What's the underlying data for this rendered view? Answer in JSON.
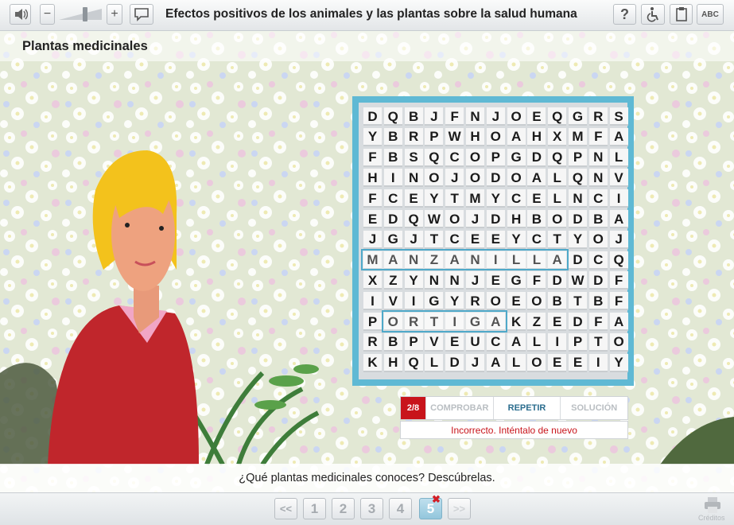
{
  "app": {
    "title": "Efectos positivos de los animales y las plantas sobre la salud humana",
    "tools": {
      "help_icon": "question-mark",
      "accessibility_icon": "wheelchair",
      "copy_icon": "clipboard",
      "abc_label": "ABC"
    },
    "volume": {
      "minus": "−",
      "plus": "+",
      "level": 0.6
    }
  },
  "section": {
    "title": "Plantas medicinales"
  },
  "word_search": {
    "rows": [
      "DQBJFNJOEQGRS",
      "YBRPWHOAHXMFA",
      "FBSQCOPGDQPNL",
      "HINOJODOALQNV",
      "FCEYTMYCELNCI",
      "EDQWOJDHBODBA",
      "JGJTCEEYCTYOJ",
      "MANZANILLADCQ",
      "XZYNNJEGFDWDF",
      "IVIGYROEOBTBF",
      "PORTIGAKZEDFA",
      "RBPVEUCALIPTO",
      "KHQLDJALOEEIY"
    ],
    "found_words": [
      "MANZANILLA",
      "ORTIGA"
    ]
  },
  "controls": {
    "counter": "2/8",
    "check": "COMPROBAR",
    "repeat": "REPETIR",
    "solution": "SOLUCIÓN",
    "feedback": "Incorrecto. Inténtalo de nuevo"
  },
  "question": "¿Qué plantas medicinales conoces? Descúbrelas.",
  "pager": {
    "prev": "<<",
    "pages": [
      "1",
      "2",
      "3",
      "4",
      "5"
    ],
    "current": "5",
    "next": ">>",
    "current_mark": "✖"
  },
  "footer": {
    "credits": "Créditos"
  }
}
